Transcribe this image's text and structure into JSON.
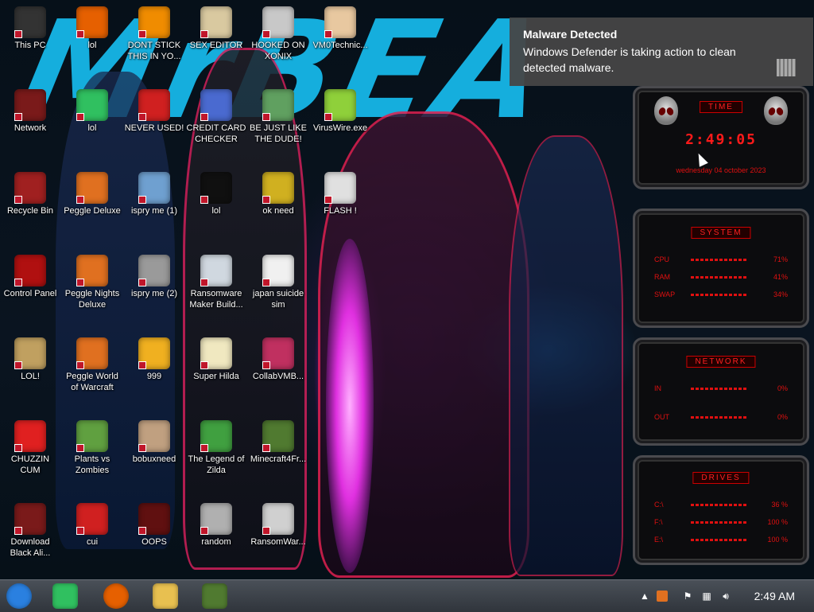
{
  "wallpaper": {
    "brand_text": "MrBEA",
    "accent": "#16b7e8"
  },
  "desktop_icons": [
    {
      "label": "This PC",
      "icon": "computer-icon",
      "color": "#333",
      "col": 0,
      "row": 0
    },
    {
      "label": "lol",
      "icon": "firefox-icon",
      "color": "#e66000",
      "col": 1,
      "row": 0
    },
    {
      "label": "DONT STICK\nTHIS IN YO...",
      "icon": "vlc-icon",
      "color": "#f08c00",
      "col": 2,
      "row": 0
    },
    {
      "label": "SEX EDITOR",
      "icon": "hex-editor-icon",
      "color": "#d9c9a0",
      "col": 3,
      "row": 0
    },
    {
      "label": "HOOKED ON\nXONIX",
      "icon": "xonix-game-icon",
      "color": "#c8c8c8",
      "col": 4,
      "row": 0
    },
    {
      "label": "VM0Technic...",
      "icon": "doctor-icon",
      "color": "#e8c8a0",
      "col": 5,
      "row": 0
    },
    {
      "label": "Network",
      "icon": "alien-network-icon",
      "color": "#7a1a1a",
      "col": 0,
      "row": 1
    },
    {
      "label": "lol",
      "icon": "green-chat-icon",
      "color": "#30c060",
      "col": 1,
      "row": 1
    },
    {
      "label": "NEVER USED!",
      "icon": "devcpp-icon",
      "color": "#d02020",
      "col": 2,
      "row": 1
    },
    {
      "label": "CREDIT CARD\nCHECKER",
      "icon": "credit-card-icon",
      "color": "#4a6ad0",
      "col": 3,
      "row": 1
    },
    {
      "label": "BE JUST LIKE\nTHE DUDE!",
      "icon": "gnome-icon",
      "color": "#60a060",
      "col": 4,
      "row": 1
    },
    {
      "label": "VirusWire.exe",
      "icon": "lime-icon",
      "color": "#8fd03a",
      "col": 5,
      "row": 1
    },
    {
      "label": "Recycle Bin",
      "icon": "recycle-bin-icon",
      "color": "#a02020",
      "col": 0,
      "row": 2
    },
    {
      "label": "Peggle Deluxe",
      "icon": "peggle-icon",
      "color": "#e07020",
      "col": 1,
      "row": 2
    },
    {
      "label": "ispry me (1)",
      "icon": "ispy-icon",
      "color": "#6fa0d0",
      "col": 2,
      "row": 2
    },
    {
      "label": "lol",
      "icon": "cmd-icon",
      "color": "#101010",
      "col": 3,
      "row": 2
    },
    {
      "label": "ok need",
      "icon": "dog-icon",
      "color": "#d0b020",
      "col": 4,
      "row": 2
    },
    {
      "label": "FLASH !",
      "icon": "document-icon",
      "color": "#e0e0e0",
      "col": 5,
      "row": 2
    },
    {
      "label": "Control Panel",
      "icon": "control-panel-icon",
      "color": "#b01010",
      "col": 0,
      "row": 3
    },
    {
      "label": "Peggle Nights\nDeluxe",
      "icon": "peggle-nights-icon",
      "color": "#e07020",
      "col": 1,
      "row": 3
    },
    {
      "label": "ispry me (2)",
      "icon": "windows-stack-icon",
      "color": "#9a9a9a",
      "col": 2,
      "row": 3
    },
    {
      "label": "Ransomware\nMaker Build...",
      "icon": "installer-icon",
      "color": "#d0d8e0",
      "col": 3,
      "row": 3
    },
    {
      "label": "japan suicide\nsim",
      "icon": "file-icon",
      "color": "#f0f0f0",
      "col": 4,
      "row": 3
    },
    {
      "label": "LOL!",
      "icon": "money-bag-icon",
      "color": "#c0a060",
      "col": 0,
      "row": 4
    },
    {
      "label": "Peggle World\nof Warcraft",
      "icon": "peggle-wow-icon",
      "color": "#e07020",
      "col": 1,
      "row": 4
    },
    {
      "label": "999",
      "icon": "de-icon",
      "color": "#f0b020",
      "col": 2,
      "row": 4
    },
    {
      "label": "Super Hilda",
      "icon": "pixel-game-icon",
      "color": "#f0e8c0",
      "col": 3,
      "row": 4
    },
    {
      "label": "CollabVMB...",
      "icon": "monitor-icon",
      "color": "#c03060",
      "col": 4,
      "row": 4
    },
    {
      "label": "CHUZZIN\nCUM",
      "icon": "chuzzle-icon",
      "color": "#e02020",
      "col": 0,
      "row": 5
    },
    {
      "label": "Plants vs\nZombies",
      "icon": "flower-icon",
      "color": "#60a040",
      "col": 1,
      "row": 5
    },
    {
      "label": "bobuxneed",
      "icon": "portrait-icon",
      "color": "#c0a080",
      "col": 2,
      "row": 5
    },
    {
      "label": "The Legend of\nZilda",
      "icon": "zelda-icon",
      "color": "#40a040",
      "col": 3,
      "row": 5
    },
    {
      "label": "Minecraft4Fr...",
      "icon": "minecraft-icon",
      "color": "#507a30",
      "col": 4,
      "row": 5
    },
    {
      "label": "Download\nBlack Ali...",
      "icon": "alien-icon",
      "color": "#7a1a1a",
      "col": 0,
      "row": 6
    },
    {
      "label": "cui",
      "icon": "radiation-icon",
      "color": "#d02020",
      "col": 1,
      "row": 6
    },
    {
      "label": "OOPS",
      "icon": "monitor-red-icon",
      "color": "#601010",
      "col": 2,
      "row": 6
    },
    {
      "label": "random",
      "icon": "gear-icon",
      "color": "#b0b0b0",
      "col": 3,
      "row": 6
    },
    {
      "label": "RansomWar...",
      "icon": "skull-icon",
      "color": "#d0d0d0",
      "col": 4,
      "row": 6
    }
  ],
  "notification": {
    "title": "Malware Detected",
    "body": "Windows Defender is taking action to clean detected malware."
  },
  "widget": {
    "time": {
      "title": "TIME",
      "clock": "2:49:05",
      "date": "wednesday 04 october 2023"
    },
    "system": {
      "title": "SYSTEM",
      "rows": [
        {
          "label": "CPU",
          "value": "71%"
        },
        {
          "label": "RAM",
          "value": "41%"
        },
        {
          "label": "SWAP",
          "value": "34%"
        }
      ]
    },
    "network": {
      "title": "NETWORK",
      "rows": [
        {
          "label": "IN",
          "value": "0%"
        },
        {
          "label": "OUT",
          "value": "0%"
        }
      ]
    },
    "drives": {
      "title": "DRIVES",
      "rows": [
        {
          "label": "C:\\",
          "value": "36 %"
        },
        {
          "label": "F:\\",
          "value": "100 %"
        },
        {
          "label": "E:\\",
          "value": "100 %"
        }
      ]
    },
    "accent": "#e01010"
  },
  "taskbar": {
    "clock": "2:49 AM",
    "pinned": [
      {
        "name": "start-orb",
        "color": "#2a80e0"
      },
      {
        "name": "green-chat",
        "color": "#30c060"
      },
      {
        "name": "firefox",
        "color": "#e66000"
      },
      {
        "name": "file-explorer",
        "color": "#e8c050"
      },
      {
        "name": "minecraft",
        "color": "#507a30"
      }
    ]
  }
}
